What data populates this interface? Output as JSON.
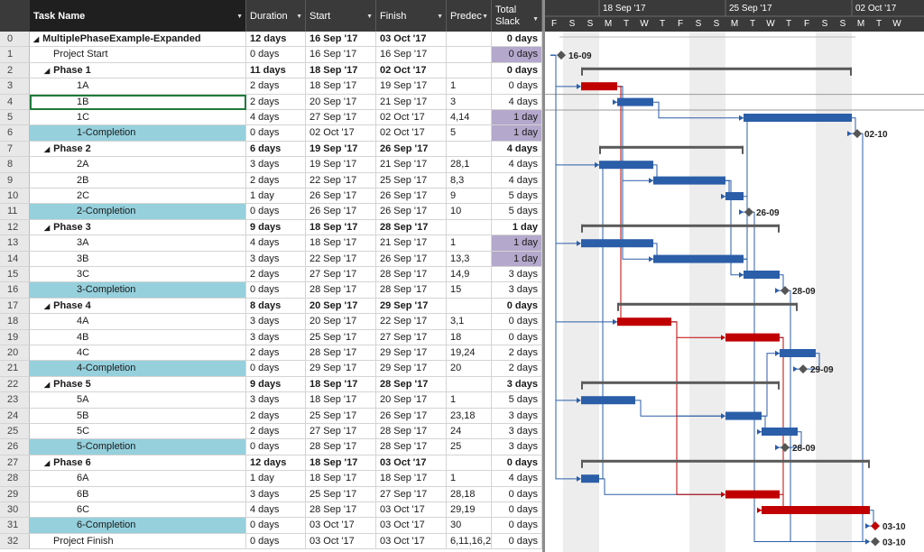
{
  "columns": {
    "name": "Task Name",
    "duration": "Duration",
    "start": "Start",
    "finish": "Finish",
    "predecessors": "Predec",
    "slack_line1": "Total",
    "slack_line2": "Slack"
  },
  "timescale": {
    "weeks": [
      "18 Sep '17",
      "25 Sep '17",
      "02 Oct '17"
    ],
    "days": [
      "F",
      "S",
      "S",
      "M",
      "T",
      "W",
      "T",
      "F",
      "S",
      "S",
      "M",
      "T",
      "W",
      "T",
      "F",
      "S",
      "S",
      "M",
      "T",
      "W"
    ]
  },
  "tasks": [
    {
      "id": "0",
      "name": "MultiplePhaseExample-Expanded",
      "duration": "12 days",
      "start": "16 Sep '17",
      "finish": "03 Oct '17",
      "pred": "",
      "slack": "0 days",
      "level": 0,
      "summary": true,
      "s": 0,
      "e": 17
    },
    {
      "id": "1",
      "name": "Project Start",
      "duration": "0 days",
      "start": "16 Sep '17",
      "finish": "16 Sep '17",
      "pred": "",
      "slack": "0 days",
      "level": 1,
      "milestone": true,
      "critSlack": true,
      "s": 0,
      "label": "16-09"
    },
    {
      "id": "2",
      "name": "Phase 1",
      "duration": "11 days",
      "start": "18 Sep '17",
      "finish": "02 Oct '17",
      "pred": "",
      "slack": "0 days",
      "level": 1,
      "summary": true,
      "s": 2,
      "e": 17
    },
    {
      "id": "3",
      "name": "1A",
      "duration": "2 days",
      "start": "18 Sep '17",
      "finish": "19 Sep '17",
      "pred": "1",
      "slack": "0 days",
      "level": 2,
      "s": 2,
      "e": 4,
      "critical": true
    },
    {
      "id": "4",
      "name": "1B",
      "duration": "2 days",
      "start": "20 Sep '17",
      "finish": "21 Sep '17",
      "pred": "3",
      "slack": "4 days",
      "level": 2,
      "s": 4,
      "e": 6,
      "selected": true
    },
    {
      "id": "5",
      "name": "1C",
      "duration": "4 days",
      "start": "27 Sep '17",
      "finish": "02 Oct '17",
      "pred": "4,14",
      "slack": "1 day",
      "level": 2,
      "s": 11,
      "e": 17,
      "critSlack": true
    },
    {
      "id": "6",
      "name": "1-Completion",
      "duration": "0 days",
      "start": "02 Oct '17",
      "finish": "02 Oct '17",
      "pred": "5",
      "slack": "1 day",
      "level": 2,
      "milestone": true,
      "completion": true,
      "critSlack": true,
      "s": 17,
      "label": "02-10"
    },
    {
      "id": "7",
      "name": "Phase 2",
      "duration": "6 days",
      "start": "19 Sep '17",
      "finish": "26 Sep '17",
      "pred": "",
      "slack": "4 days",
      "level": 1,
      "summary": true,
      "s": 3,
      "e": 11
    },
    {
      "id": "8",
      "name": "2A",
      "duration": "3 days",
      "start": "19 Sep '17",
      "finish": "21 Sep '17",
      "pred": "28,1",
      "slack": "4 days",
      "level": 2,
      "s": 3,
      "e": 6
    },
    {
      "id": "9",
      "name": "2B",
      "duration": "2 days",
      "start": "22 Sep '17",
      "finish": "25 Sep '17",
      "pred": "8,3",
      "slack": "4 days",
      "level": 2,
      "s": 6,
      "e": 10
    },
    {
      "id": "10",
      "name": "2C",
      "duration": "1 day",
      "start": "26 Sep '17",
      "finish": "26 Sep '17",
      "pred": "9",
      "slack": "5 days",
      "level": 2,
      "s": 10,
      "e": 11
    },
    {
      "id": "11",
      "name": "2-Completion",
      "duration": "0 days",
      "start": "26 Sep '17",
      "finish": "26 Sep '17",
      "pred": "10",
      "slack": "5 days",
      "level": 2,
      "milestone": true,
      "completion": true,
      "s": 11,
      "label": "26-09"
    },
    {
      "id": "12",
      "name": "Phase 3",
      "duration": "9 days",
      "start": "18 Sep '17",
      "finish": "28 Sep '17",
      "pred": "",
      "slack": "1 day",
      "level": 1,
      "summary": true,
      "s": 2,
      "e": 13
    },
    {
      "id": "13",
      "name": "3A",
      "duration": "4 days",
      "start": "18 Sep '17",
      "finish": "21 Sep '17",
      "pred": "1",
      "slack": "1 day",
      "level": 2,
      "s": 2,
      "e": 6,
      "critSlack": true
    },
    {
      "id": "14",
      "name": "3B",
      "duration": "3 days",
      "start": "22 Sep '17",
      "finish": "26 Sep '17",
      "pred": "13,3",
      "slack": "1 day",
      "level": 2,
      "s": 6,
      "e": 11,
      "critSlack": true
    },
    {
      "id": "15",
      "name": "3C",
      "duration": "2 days",
      "start": "27 Sep '17",
      "finish": "28 Sep '17",
      "pred": "14,9",
      "slack": "3 days",
      "level": 2,
      "s": 11,
      "e": 13
    },
    {
      "id": "16",
      "name": "3-Completion",
      "duration": "0 days",
      "start": "28 Sep '17",
      "finish": "28 Sep '17",
      "pred": "15",
      "slack": "3 days",
      "level": 2,
      "milestone": true,
      "completion": true,
      "s": 13,
      "label": "28-09"
    },
    {
      "id": "17",
      "name": "Phase 4",
      "duration": "8 days",
      "start": "20 Sep '17",
      "finish": "29 Sep '17",
      "pred": "",
      "slack": "0 days",
      "level": 1,
      "summary": true,
      "s": 4,
      "e": 14
    },
    {
      "id": "18",
      "name": "4A",
      "duration": "3 days",
      "start": "20 Sep '17",
      "finish": "22 Sep '17",
      "pred": "3,1",
      "slack": "0 days",
      "level": 2,
      "s": 4,
      "e": 7,
      "critical": true
    },
    {
      "id": "19",
      "name": "4B",
      "duration": "3 days",
      "start": "25 Sep '17",
      "finish": "27 Sep '17",
      "pred": "18",
      "slack": "0 days",
      "level": 2,
      "s": 10,
      "e": 13,
      "critical": true
    },
    {
      "id": "20",
      "name": "4C",
      "duration": "2 days",
      "start": "28 Sep '17",
      "finish": "29 Sep '17",
      "pred": "19,24",
      "slack": "2 days",
      "level": 2,
      "s": 13,
      "e": 15
    },
    {
      "id": "21",
      "name": "4-Completion",
      "duration": "0 days",
      "start": "29 Sep '17",
      "finish": "29 Sep '17",
      "pred": "20",
      "slack": "2 days",
      "level": 2,
      "milestone": true,
      "completion": true,
      "s": 14,
      "label": "29-09"
    },
    {
      "id": "22",
      "name": "Phase 5",
      "duration": "9 days",
      "start": "18 Sep '17",
      "finish": "28 Sep '17",
      "pred": "",
      "slack": "3 days",
      "level": 1,
      "summary": true,
      "s": 2,
      "e": 13
    },
    {
      "id": "23",
      "name": "5A",
      "duration": "3 days",
      "start": "18 Sep '17",
      "finish": "20 Sep '17",
      "pred": "1",
      "slack": "5 days",
      "level": 2,
      "s": 2,
      "e": 5
    },
    {
      "id": "24",
      "name": "5B",
      "duration": "2 days",
      "start": "25 Sep '17",
      "finish": "26 Sep '17",
      "pred": "23,18",
      "slack": "3 days",
      "level": 2,
      "s": 10,
      "e": 12
    },
    {
      "id": "25",
      "name": "5C",
      "duration": "2 days",
      "start": "27 Sep '17",
      "finish": "28 Sep '17",
      "pred": "24",
      "slack": "3 days",
      "level": 2,
      "s": 12,
      "e": 14
    },
    {
      "id": "26",
      "name": "5-Completion",
      "duration": "0 days",
      "start": "28 Sep '17",
      "finish": "28 Sep '17",
      "pred": "25",
      "slack": "3 days",
      "level": 2,
      "milestone": true,
      "completion": true,
      "s": 13,
      "label": "28-09"
    },
    {
      "id": "27",
      "name": "Phase 6",
      "duration": "12 days",
      "start": "18 Sep '17",
      "finish": "03 Oct '17",
      "pred": "",
      "slack": "0 days",
      "level": 1,
      "summary": true,
      "s": 2,
      "e": 18
    },
    {
      "id": "28",
      "name": "6A",
      "duration": "1 day",
      "start": "18 Sep '17",
      "finish": "18 Sep '17",
      "pred": "1",
      "slack": "4 days",
      "level": 2,
      "s": 2,
      "e": 3
    },
    {
      "id": "29",
      "name": "6B",
      "duration": "3 days",
      "start": "25 Sep '17",
      "finish": "27 Sep '17",
      "pred": "28,18",
      "slack": "0 days",
      "level": 2,
      "s": 10,
      "e": 13,
      "critical": true
    },
    {
      "id": "30",
      "name": "6C",
      "duration": "4 days",
      "start": "28 Sep '17",
      "finish": "03 Oct '17",
      "pred": "29,19",
      "slack": "0 days",
      "level": 2,
      "s": 12,
      "e": 18,
      "critical": true
    },
    {
      "id": "31",
      "name": "6-Completion",
      "duration": "0 days",
      "start": "03 Oct '17",
      "finish": "03 Oct '17",
      "pred": "30",
      "slack": "0 days",
      "level": 2,
      "milestone": true,
      "completion": true,
      "s": 18,
      "label": "03-10",
      "critMs": true
    },
    {
      "id": "32",
      "name": "Project Finish",
      "duration": "0 days",
      "start": "03 Oct '17",
      "finish": "03 Oct '17",
      "pred": "6,11,16,2",
      "slack": "0 days",
      "level": 1,
      "milestone": true,
      "s": 18,
      "label": "03-10"
    }
  ],
  "colors": {
    "bar": "#2b5ea8",
    "critical": "#c00000",
    "summary": "#5a5a5a",
    "weekend": "#ededed",
    "completion_cell": "#95d0dc",
    "crit_slack_cell": "#b4a8cc"
  }
}
